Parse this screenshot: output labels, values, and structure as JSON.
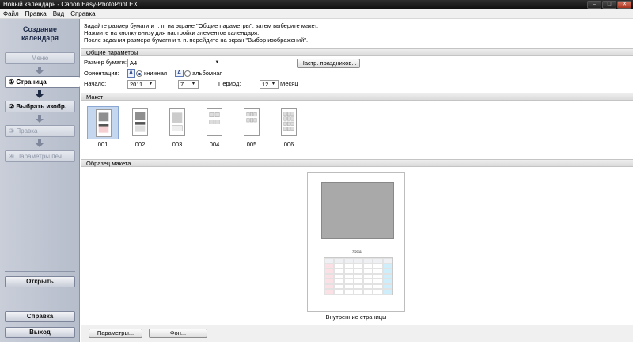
{
  "window": {
    "title": "Новый календарь - Canon Easy-PhotoPrint EX",
    "min": "–",
    "max": "□",
    "close": "✕"
  },
  "menu": [
    "Файл",
    "Правка",
    "Вид",
    "Справка"
  ],
  "sidebar": {
    "title_line1": "Создание",
    "title_line2": "календаря",
    "steps": [
      {
        "label": "Меню"
      },
      {
        "label": "①  Страница"
      },
      {
        "label": "② Выбрать изобр."
      },
      {
        "label": "③  Правка"
      },
      {
        "label": "④ Параметры печ."
      }
    ],
    "open_button": "Открыть",
    "help_button": "Справка",
    "exit_button": "Выход"
  },
  "instructions": [
    "Задайте размер бумаги и т. п. на экране \"Общие параметры\", затем выберите макет.",
    "Нажмите на кнопку внизу для настройки элементов календаря.",
    "После задания размера бумаги и т. п. перейдите на экран \"Выбор изображений\"."
  ],
  "general": {
    "header": "Общие параметры",
    "paper_label": "Размер бумаги:",
    "paper_value": "A4",
    "holidays_button": "Настр. праздников...",
    "orientation_label": "Ориентация:",
    "portrait": "книжная",
    "landscape": "альбомная",
    "start_label": "Начало:",
    "start_year": "2011",
    "start_month": "7",
    "period_label": "Период:",
    "period_value": "12",
    "period_unit": "Месяц"
  },
  "layouts": {
    "header": "Макет",
    "items": [
      "001",
      "002",
      "003",
      "004",
      "005",
      "006"
    ],
    "selected": "001"
  },
  "preview": {
    "header": "Образец макета",
    "month": "7/2011",
    "caption": "Внутренние страницы"
  },
  "bottom": {
    "params_button": "Параметры...",
    "bg_button": "Фон..."
  },
  "colors": {
    "accent": "#1b3e8c",
    "sidebar": "#c0c6d3",
    "selected_layout": "#c5d6ef"
  }
}
